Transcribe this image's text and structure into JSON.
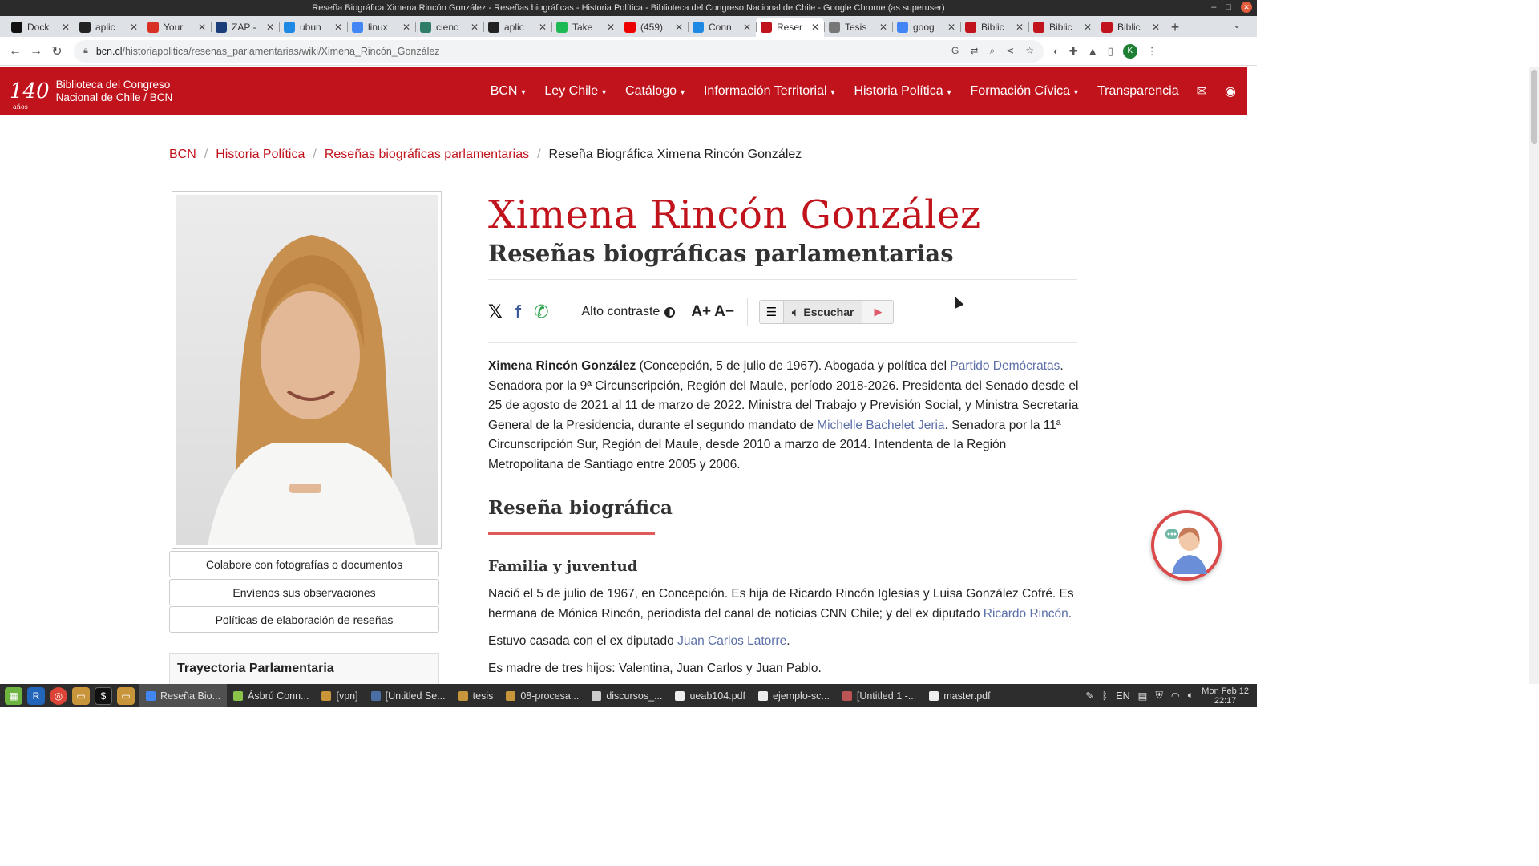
{
  "window": {
    "title": "Reseña Biográfica Ximena Rincón González - Reseñas biográficas - Historia Política - Biblioteca del Congreso Nacional de Chile - Google Chrome (as superuser)"
  },
  "tabs": [
    {
      "label": "Dock",
      "color": "#111"
    },
    {
      "label": "aplic",
      "color": "#222"
    },
    {
      "label": "Your",
      "color": "#d93025"
    },
    {
      "label": "ZAP -",
      "color": "#1a3e7a"
    },
    {
      "label": "ubun",
      "color": "#1e88e5"
    },
    {
      "label": "linux",
      "color": "#4285f4"
    },
    {
      "label": "cienc",
      "color": "#2e7d6b"
    },
    {
      "label": "aplic",
      "color": "#222"
    },
    {
      "label": "Take",
      "color": "#1db954"
    },
    {
      "label": "(459)",
      "color": "#e00"
    },
    {
      "label": "Conn",
      "color": "#1e88e5"
    },
    {
      "label": "Reser",
      "color": "#c1131c",
      "active": true
    },
    {
      "label": "Tesis",
      "color": "#777"
    },
    {
      "label": "goog",
      "color": "#4285f4"
    },
    {
      "label": "Biblic",
      "color": "#c1131c"
    },
    {
      "label": "Biblic",
      "color": "#c1131c"
    },
    {
      "label": "Biblic",
      "color": "#c1131c"
    }
  ],
  "address": {
    "host": "bcn.cl",
    "path": "/historiapolitica/resenas_parlamentarias/wiki/Ximena_Rincón_González"
  },
  "site": {
    "logo_number": "140",
    "logo_years": "años",
    "logo_line1": "Biblioteca del Congreso",
    "logo_line2": "Nacional de Chile / BCN",
    "nav": [
      "BCN",
      "Ley Chile",
      "Catálogo",
      "Información Territorial",
      "Historia Política",
      "Formación Cívica"
    ],
    "nav_plain": "Transparencia"
  },
  "breadcrumb": {
    "b1": "BCN",
    "b2": "Historia Política",
    "b3": "Reseñas biográficas parlamentarias",
    "current": "Reseña Biográfica Ximena Rincón González"
  },
  "sidebar": {
    "btn1": "Colabore con fotografías o documentos",
    "btn2": "Envíenos sus observaciones",
    "btn3": "Políticas de elaboración de reseñas",
    "trayectoria": "Trayectoria Parlamentaria"
  },
  "page": {
    "title": "Ximena Rincón González",
    "subtitle": "Reseñas biográficas parlamentarias",
    "contrast_label": "Alto contraste",
    "font_plus": "A+",
    "font_minus": "A−",
    "listen_label": "Escuchar"
  },
  "bio": {
    "name": "Ximena Rincón González",
    "t1": " (Concepción, 5 de julio de 1967). Abogada y política del ",
    "link1": "Partido Demócratas",
    "t2": ". Senadora por la 9ª Circunscripción, Región del Maule, período 2018-2026. Presidenta del Senado desde el 25 de agosto de 2021 al 11 de marzo de 2022. Ministra del Trabajo y Previsión Social, y Ministra Secretaria General de la Presidencia, durante el segundo mandato de ",
    "link2": "Michelle Bachelet Jeria",
    "t3": ". Senadora por la 11ª Circunscripción Sur, Región del Maule, desde 2010 a marzo de 2014. Intendenta de la Región Metropolitana de Santiago entre 2005 y 2006."
  },
  "section": {
    "h2": "Reseña biográfica",
    "h3": "Familia y juventud",
    "p1a": "Nació el 5 de julio de 1967, en Concepción. Es hija de Ricardo Rincón Iglesias y Luisa González Cofré. Es hermana de Mónica Rincón, periodista del canal de noticias CNN Chile; y del ex diputado ",
    "p1link": "Ricardo Rincón",
    "p1b": ".",
    "p2a": "Estuvo casada con el ex diputado ",
    "p2link": "Juan Carlos Latorre",
    "p2b": ".",
    "p3": "Es madre de tres hijos: Valentina, Juan Carlos y Juan Pablo."
  },
  "taskbar": {
    "windows": [
      {
        "label": "Reseña Bio...",
        "active": true,
        "color": "#4285f4"
      },
      {
        "label": "Ásbrú Conn...",
        "color": "#8bc34a"
      },
      {
        "label": "[vpn]",
        "color": "#c8953b"
      },
      {
        "label": "[Untitled Se...",
        "color": "#4a6fa5"
      },
      {
        "label": "tesis",
        "color": "#c8953b"
      },
      {
        "label": "08-procesa...",
        "color": "#c8953b"
      },
      {
        "label": "discursos_...",
        "color": "#ccc"
      },
      {
        "label": "ueab104.pdf",
        "color": "#eee"
      },
      {
        "label": "ejemplo-sc...",
        "color": "#eee"
      },
      {
        "label": "[Untitled 1 -...",
        "color": "#b55"
      },
      {
        "label": "master.pdf",
        "color": "#eee"
      }
    ],
    "lang": "EN",
    "date": "Mon Feb 12",
    "time": "22:17"
  }
}
